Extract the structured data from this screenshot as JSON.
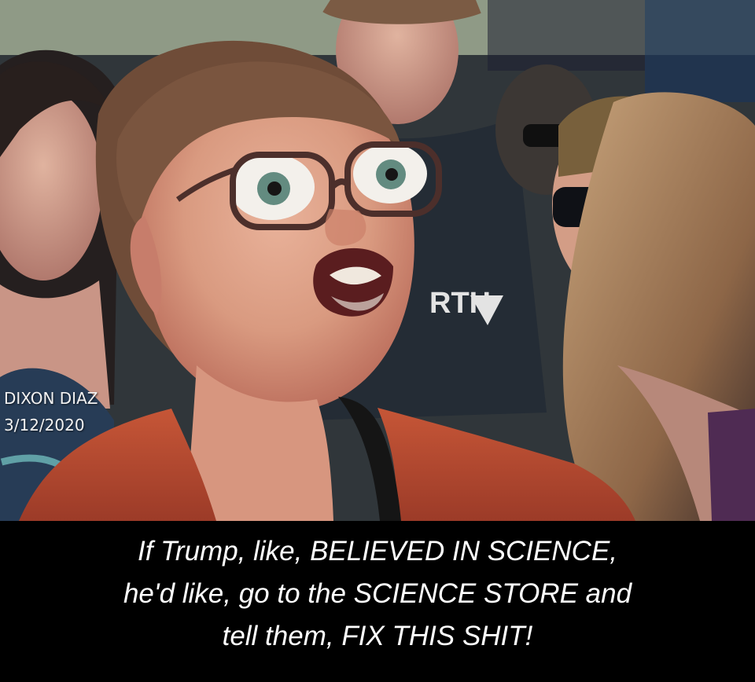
{
  "image": {
    "scene": "crowd-closeup-photo",
    "watermark": {
      "line1": "DIXON DIAZ",
      "line2": "3/12/2020"
    },
    "caption": {
      "lines": [
        "If Trump, like, BELIEVED IN SCIENCE,",
        "he'd like, go to the SCIENCE STORE and",
        "tell them, FIX THIS SHIT!"
      ]
    },
    "shirt_text": "RTH"
  },
  "colors": {
    "caption_bg": "#000000",
    "caption_text": "#ffffff",
    "shirt": "#c84d2f",
    "skin": "#d89a80",
    "hair": "#74513b",
    "glasses": "#4c2f2b"
  }
}
